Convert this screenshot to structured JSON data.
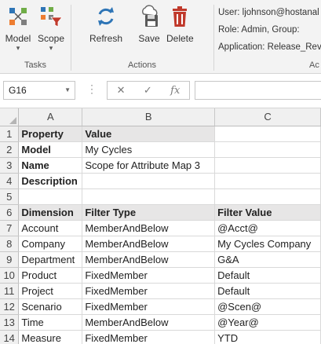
{
  "ribbon": {
    "tasks_group": {
      "label": "Tasks",
      "buttons": [
        {
          "label": "Model",
          "icon": "model-icon"
        },
        {
          "label": "Scope",
          "icon": "scope-filter-icon"
        }
      ]
    },
    "actions_group": {
      "label": "Actions",
      "buttons": [
        {
          "label": "Refresh",
          "icon": "refresh-icon"
        },
        {
          "label": "Save",
          "icon": "save-icon"
        },
        {
          "label": "Delete",
          "icon": "trash-icon"
        }
      ]
    },
    "account_group": {
      "label": "Ac",
      "user": "User: ljohnson@hostanal",
      "role": "Role: Admin, Group:",
      "application": "Application: Release_Rev"
    }
  },
  "formula_bar": {
    "name_box": "G16",
    "cancel_glyph": "✕",
    "enter_glyph": "✓",
    "fx_glyph": "fx",
    "formula": ""
  },
  "sheet": {
    "columns": [
      "A",
      "B",
      "C"
    ],
    "rows": [
      {
        "num": "1",
        "cells": [
          "Property",
          "Value",
          ""
        ],
        "bold": [
          true,
          true,
          false
        ],
        "shaded": [
          true,
          true,
          false
        ]
      },
      {
        "num": "2",
        "cells": [
          "Model",
          "My Cycles",
          ""
        ],
        "bold": [
          true,
          false,
          false
        ],
        "shaded": [
          false,
          false,
          false
        ]
      },
      {
        "num": "3",
        "cells": [
          "Name",
          "Scope for Attribute Map 3",
          ""
        ],
        "bold": [
          true,
          false,
          false
        ],
        "shaded": [
          false,
          false,
          false
        ]
      },
      {
        "num": "4",
        "cells": [
          "Description",
          "",
          ""
        ],
        "bold": [
          true,
          false,
          false
        ],
        "shaded": [
          false,
          false,
          false
        ]
      },
      {
        "num": "5",
        "cells": [
          "",
          "",
          ""
        ],
        "bold": [
          false,
          false,
          false
        ],
        "shaded": [
          false,
          false,
          false
        ]
      },
      {
        "num": "6",
        "cells": [
          "Dimension",
          "Filter Type",
          "Filter Value"
        ],
        "bold": [
          true,
          true,
          true
        ],
        "shaded": [
          true,
          true,
          true
        ]
      },
      {
        "num": "7",
        "cells": [
          "Account",
          "MemberAndBelow",
          "@Acct@"
        ],
        "bold": [
          false,
          false,
          false
        ],
        "shaded": [
          false,
          false,
          false
        ]
      },
      {
        "num": "8",
        "cells": [
          "Company",
          "MemberAndBelow",
          "My Cycles Company"
        ],
        "bold": [
          false,
          false,
          false
        ],
        "shaded": [
          false,
          false,
          false
        ]
      },
      {
        "num": "9",
        "cells": [
          "Department",
          "MemberAndBelow",
          "G&A"
        ],
        "bold": [
          false,
          false,
          false
        ],
        "shaded": [
          false,
          false,
          false
        ]
      },
      {
        "num": "10",
        "cells": [
          "Product",
          "FixedMember",
          "Default"
        ],
        "bold": [
          false,
          false,
          false
        ],
        "shaded": [
          false,
          false,
          false
        ]
      },
      {
        "num": "11",
        "cells": [
          "Project",
          "FixedMember",
          "Default"
        ],
        "bold": [
          false,
          false,
          false
        ],
        "shaded": [
          false,
          false,
          false
        ]
      },
      {
        "num": "12",
        "cells": [
          "Scenario",
          "FixedMember",
          "@Scen@"
        ],
        "bold": [
          false,
          false,
          false
        ],
        "shaded": [
          false,
          false,
          false
        ]
      },
      {
        "num": "13",
        "cells": [
          "Time",
          "MemberAndBelow",
          "@Year@"
        ],
        "bold": [
          false,
          false,
          false
        ],
        "shaded": [
          false,
          false,
          false
        ]
      },
      {
        "num": "14",
        "cells": [
          "Measure",
          "FixedMember",
          "YTD"
        ],
        "bold": [
          false,
          false,
          false
        ],
        "shaded": [
          false,
          false,
          false
        ]
      }
    ]
  },
  "colors": {
    "refresh_blue": "#2e75b6",
    "delete_red": "#c0392b",
    "header_shade": "#e7e6e6",
    "gridline": "#d9d9d9"
  }
}
